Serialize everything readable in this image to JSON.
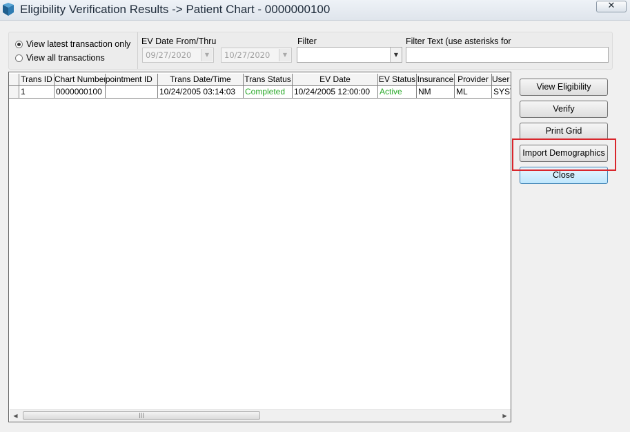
{
  "window": {
    "title": "Eligibility Verification Results -> Patient Chart - 0000000100",
    "close_label": "✕"
  },
  "filters": {
    "radio_latest": "View latest transaction only",
    "radio_all": "View all transactions",
    "radio_selected": "latest",
    "ev_date_label": "EV Date From/Thru",
    "date_from": "09/27/2020",
    "date_thru": "10/27/2020",
    "filter_label": "Filter",
    "filter_value": "",
    "filter_text_label": "Filter Text (use asterisks for",
    "filter_text_value": ""
  },
  "grid": {
    "columns": [
      "Trans ID",
      "Chart Number",
      "Appointment ID",
      "Trans Date/Time",
      "Trans Status",
      "EV Date",
      "EV Status",
      "Insurance",
      "Provider",
      "User"
    ],
    "rows": [
      [
        "1",
        "0000000100",
        "",
        "10/24/2005 03:14:03",
        "Completed",
        "10/24/2005 12:00:00",
        "Active",
        "NM",
        "ML",
        "SYST"
      ]
    ],
    "status_color": "#27a827"
  },
  "buttons": {
    "view_eligibility": "View Eligibility",
    "verify": "Verify",
    "print_grid": "Print Grid",
    "import_demographics": "Import Demographics",
    "close": "Close"
  },
  "highlight_color": "#d9262c"
}
